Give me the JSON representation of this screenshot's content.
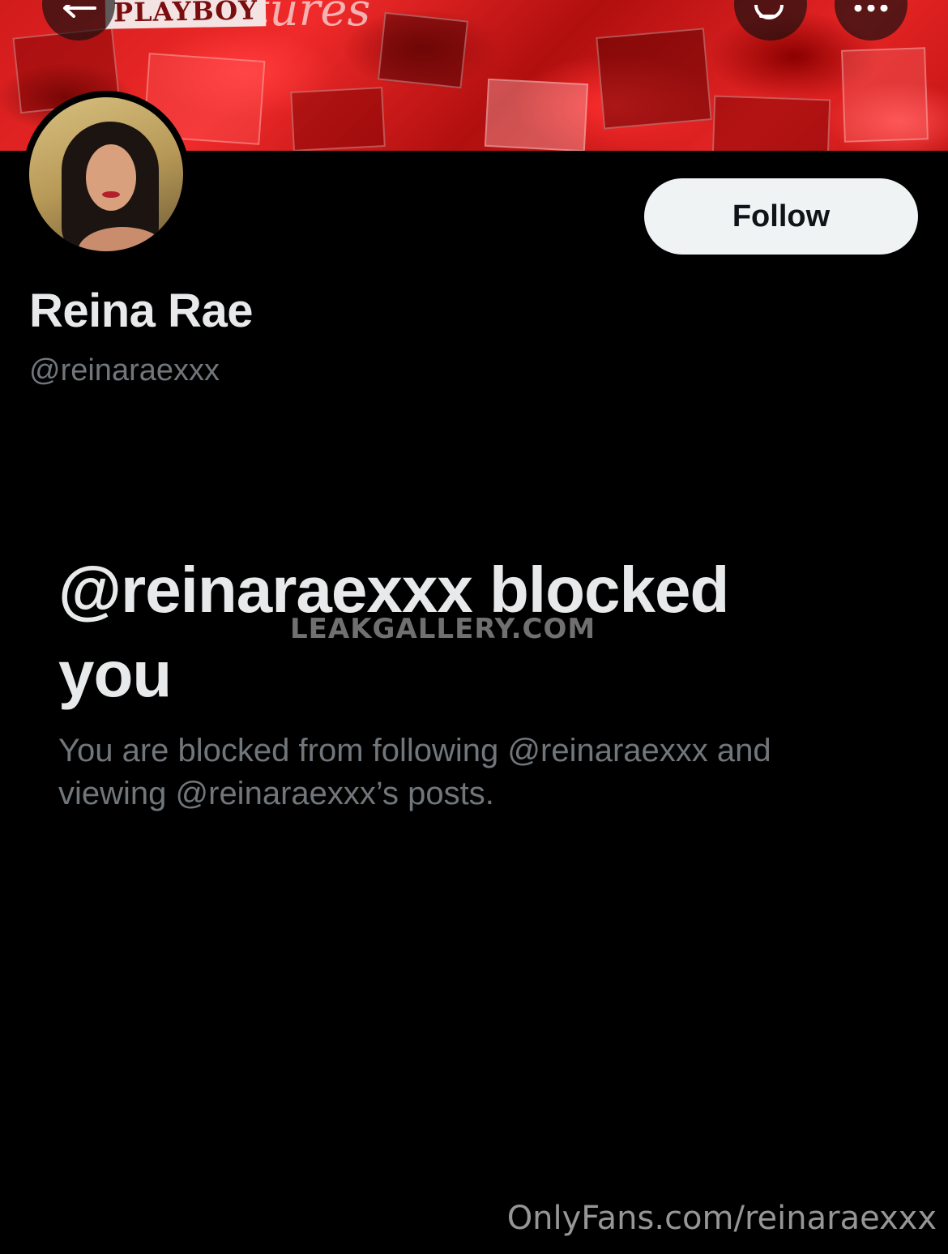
{
  "banner": {
    "logo_text": "PLAYBOY",
    "script_text": "tures"
  },
  "profile": {
    "display_name": "Reina Rae",
    "handle": "@reinaraexxx",
    "follow_label": "Follow"
  },
  "blocked": {
    "title": "@reinaraexxx blocked you",
    "description": "You are blocked from following @reinaraexxx and viewing @reinaraexxx’s posts."
  },
  "watermarks": {
    "center": "LEAKGALLERY.COM",
    "corner": "OnlyFans.com/reinaraexxx"
  },
  "icons": {
    "back": "arrow-left-icon",
    "search": "search-icon",
    "more": "more-dots-icon"
  },
  "colors": {
    "background": "#000000",
    "banner_red": "#e52424",
    "primary_text": "#e7e9ea",
    "secondary_text": "#71767b",
    "follow_button_bg": "#eff3f4",
    "follow_button_text": "#0f1419"
  }
}
